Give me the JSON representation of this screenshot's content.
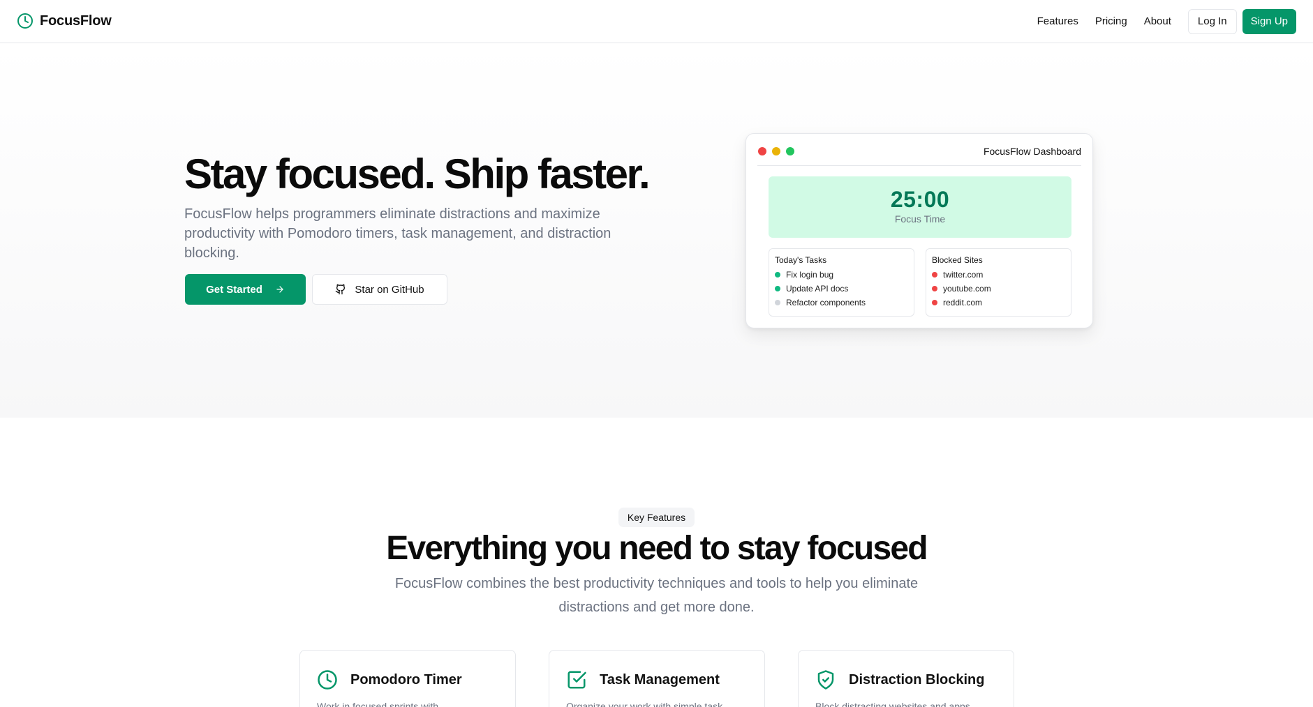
{
  "header": {
    "brand": "FocusFlow",
    "nav": [
      "Features",
      "Pricing",
      "About"
    ],
    "login_label": "Log In",
    "signup_label": "Sign Up"
  },
  "hero": {
    "title": "Stay focused. Ship faster.",
    "subtitle": "FocusFlow helps programmers eliminate distractions and maximize productivity with Pomodoro timers, task management, and distraction blocking.",
    "primary_cta": "Get Started",
    "secondary_cta": "Star on GitHub"
  },
  "dashboard": {
    "title": "FocusFlow Dashboard",
    "timer_value": "25:00",
    "timer_label": "Focus Time",
    "tasks_title": "Today's Tasks",
    "tasks": [
      {
        "label": "Fix login bug",
        "color": "#10b981"
      },
      {
        "label": "Update API docs",
        "color": "#10b981"
      },
      {
        "label": "Refactor components",
        "color": "#d1d5db"
      }
    ],
    "sites_title": "Blocked Sites",
    "sites": [
      {
        "label": "twitter.com",
        "color": "#ef4444"
      },
      {
        "label": "youtube.com",
        "color": "#ef4444"
      },
      {
        "label": "reddit.com",
        "color": "#ef4444"
      }
    ]
  },
  "features": {
    "badge": "Key Features",
    "title": "Everything you need to stay focused",
    "subtitle": "FocusFlow combines the best productivity techniques and tools to help you eliminate distractions and get more done.",
    "cards": [
      {
        "title": "Pomodoro Timer",
        "desc": "Work in focused sprints with",
        "icon": "clock-icon"
      },
      {
        "title": "Task Management",
        "desc": "Organize your work with simple task",
        "icon": "check-square-icon"
      },
      {
        "title": "Distraction Blocking",
        "desc": "Block distracting websites and apps",
        "icon": "shield-check-icon"
      }
    ]
  },
  "colors": {
    "brand": "#059669",
    "brand_dark": "#047857",
    "timer_bg": "#d1fae5"
  }
}
